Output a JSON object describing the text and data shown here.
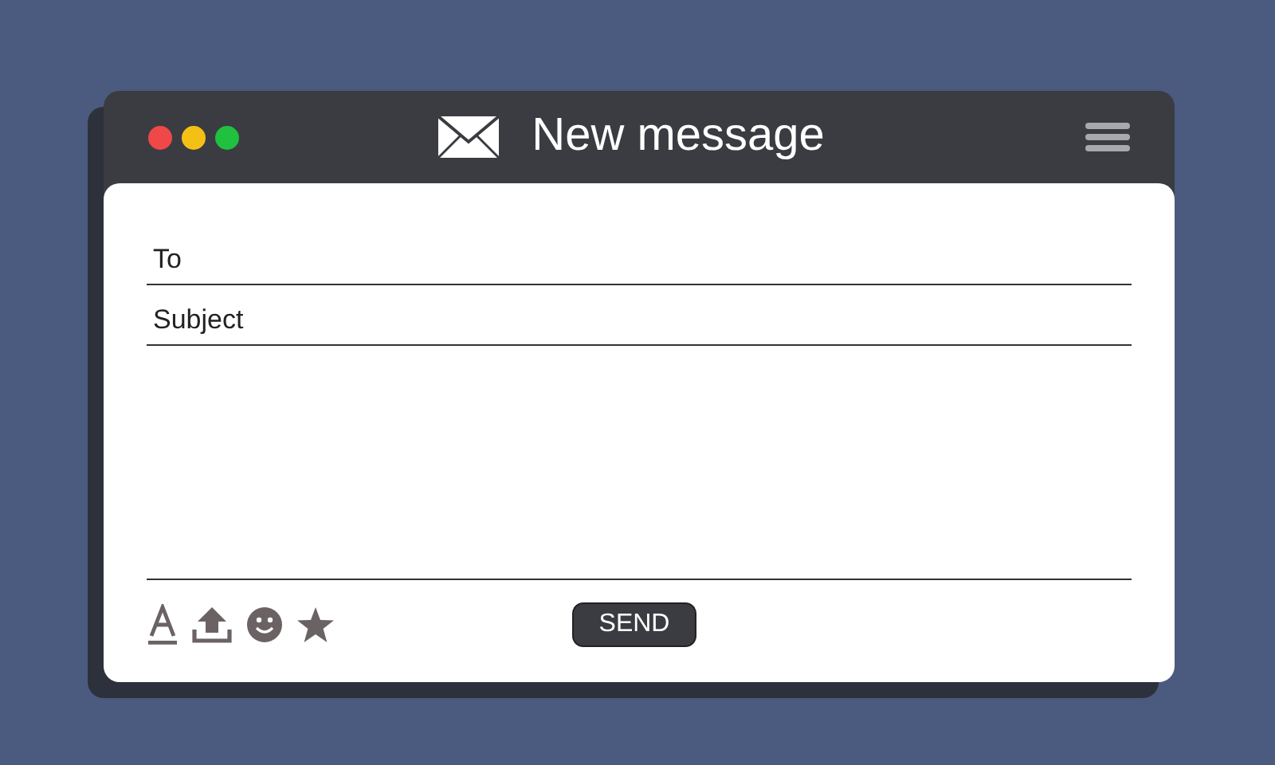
{
  "window": {
    "title": "New message",
    "controls": [
      {
        "color": "#f04848"
      },
      {
        "color": "#f5c016"
      },
      {
        "color": "#1fc13f"
      }
    ]
  },
  "fields": [
    {
      "label": "To"
    },
    {
      "label": "Subject"
    }
  ],
  "send_button": {
    "label": "SEND"
  }
}
